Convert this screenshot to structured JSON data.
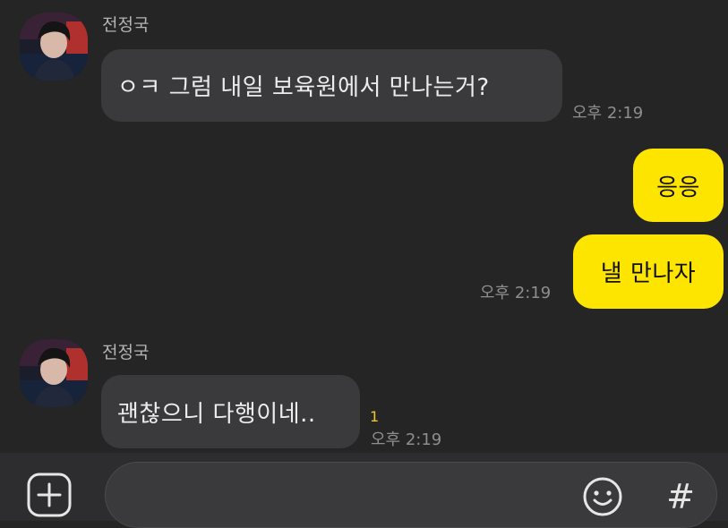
{
  "messages": [
    {
      "sender": "전정국",
      "text": "ㅇㅋ 그럼 내일 보육원에서 만나는거?",
      "time": "오후 2:19"
    },
    {
      "text": "응응"
    },
    {
      "text": "낼 만나자",
      "time": "오후 2:19"
    },
    {
      "sender": "전정국",
      "text": "괜찮으니 다행이네..",
      "unread": "1",
      "time": "오후 2:19"
    }
  ],
  "input_bar": {
    "plus_icon": "plus-square-icon",
    "emoji_icon": "emoji-icon",
    "hash_label": "#"
  },
  "colors": {
    "background": "#252526",
    "incoming_bubble": "#3a3a3c",
    "outgoing_bubble": "#fee500",
    "unread": "#f2c81e"
  }
}
